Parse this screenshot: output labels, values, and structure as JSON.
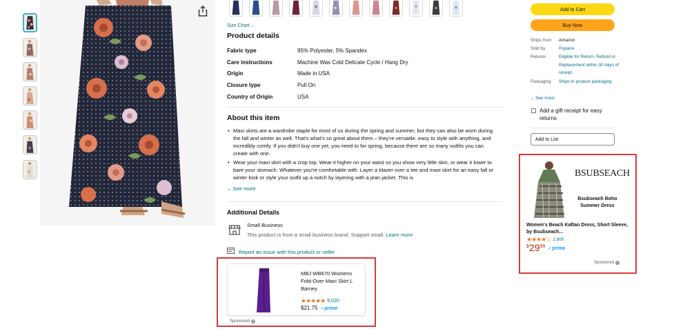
{
  "thumbnails": [
    {
      "label": "product-image-1",
      "selected": true
    },
    {
      "label": "product-image-2",
      "selected": false
    },
    {
      "label": "product-image-3",
      "selected": false
    },
    {
      "label": "product-image-4",
      "selected": false
    },
    {
      "label": "product-image-5",
      "selected": false
    },
    {
      "label": "product-image-6",
      "selected": false
    },
    {
      "label": "product-image-7",
      "selected": false
    }
  ],
  "size_chart": "Size Chart",
  "product_details": {
    "heading": "Product details",
    "rows": [
      {
        "key": "Fabric type",
        "value": "95% Polyester, 5% Spandex"
      },
      {
        "key": "Care instructions",
        "value": "Machine Was Cold Delicate Cycle / Hang Dry"
      },
      {
        "key": "Origin",
        "value": "Made in USA"
      },
      {
        "key": "Closure type",
        "value": "Pull On"
      },
      {
        "key": "Country of Origin",
        "value": "USA"
      }
    ]
  },
  "about": {
    "heading": "About this item",
    "bullets": [
      "Maxi skirts are a wardrobe staple for most of us during the spring and summer, but they can also be worn during the fall and winter as well. That's what's so great about them – they're versatile, easy to style with anything, and incredibly comfy. If you didn't buy one yet, you need to for spring, because there are so many outfits you can create with one.",
      "Wear your maxi skirt with a crop top. Wear it higher on your waist so you show very little skin, or wear it lower to bare your stomach. Whatever you're comfortable with. Layer a blazer over a tee and maxi skirt for an easy fall or winter look or style your outfit up a notch by layering with a jean jacket. This is"
    ],
    "see_more": "See more"
  },
  "additional_details": {
    "heading": "Additional Details",
    "badge_title": "Small Business",
    "badge_text": "This product is from a small business brand. Support small.",
    "learn_more": "Learn more"
  },
  "report_issue": "Report an issue with this product or seller",
  "sponsored_card": {
    "title": "MBJ WB670 Womens Fold-Over Maxi Skirt L Barney",
    "rating_count": "6,020",
    "price": "$21.75",
    "prime": "✓prime",
    "sponsored": "Sponsored"
  },
  "buy_box": {
    "add_to_cart": "Add to Cart",
    "buy_now": "Buy Now",
    "ships_from_label": "Ships from",
    "ships_from": "Amazon",
    "sold_by_label": "Sold by",
    "sold_by": "Popana",
    "returns_label": "Returns",
    "returns": "Eligible for Return, Refund or Replacement within 30 days of receipt",
    "packaging_label": "Packaging",
    "packaging": "Ships in product packaging",
    "see_more": "See more",
    "gift_receipt": "Add a gift receipt for easy returns",
    "add_to_list": "Add to List"
  },
  "ad": {
    "brand": "BSUBSEACH",
    "product_name": "Bsubseach Boho Summer Dress",
    "title": "Women's Beach Kaftan Dress, Short Sleeve, by Bsubseach...",
    "rating_count": "2,900",
    "price_currency": "$",
    "price_whole": "29",
    "price_fraction": "99",
    "prime": "✓prime",
    "sponsored": "Sponsored"
  },
  "colors": {
    "highlight_box": "#d43a3a",
    "add_to_cart": "#ffd814",
    "buy_now": "#ffa41c",
    "link": "#007185",
    "star": "#de7921",
    "price": "#b12704"
  }
}
